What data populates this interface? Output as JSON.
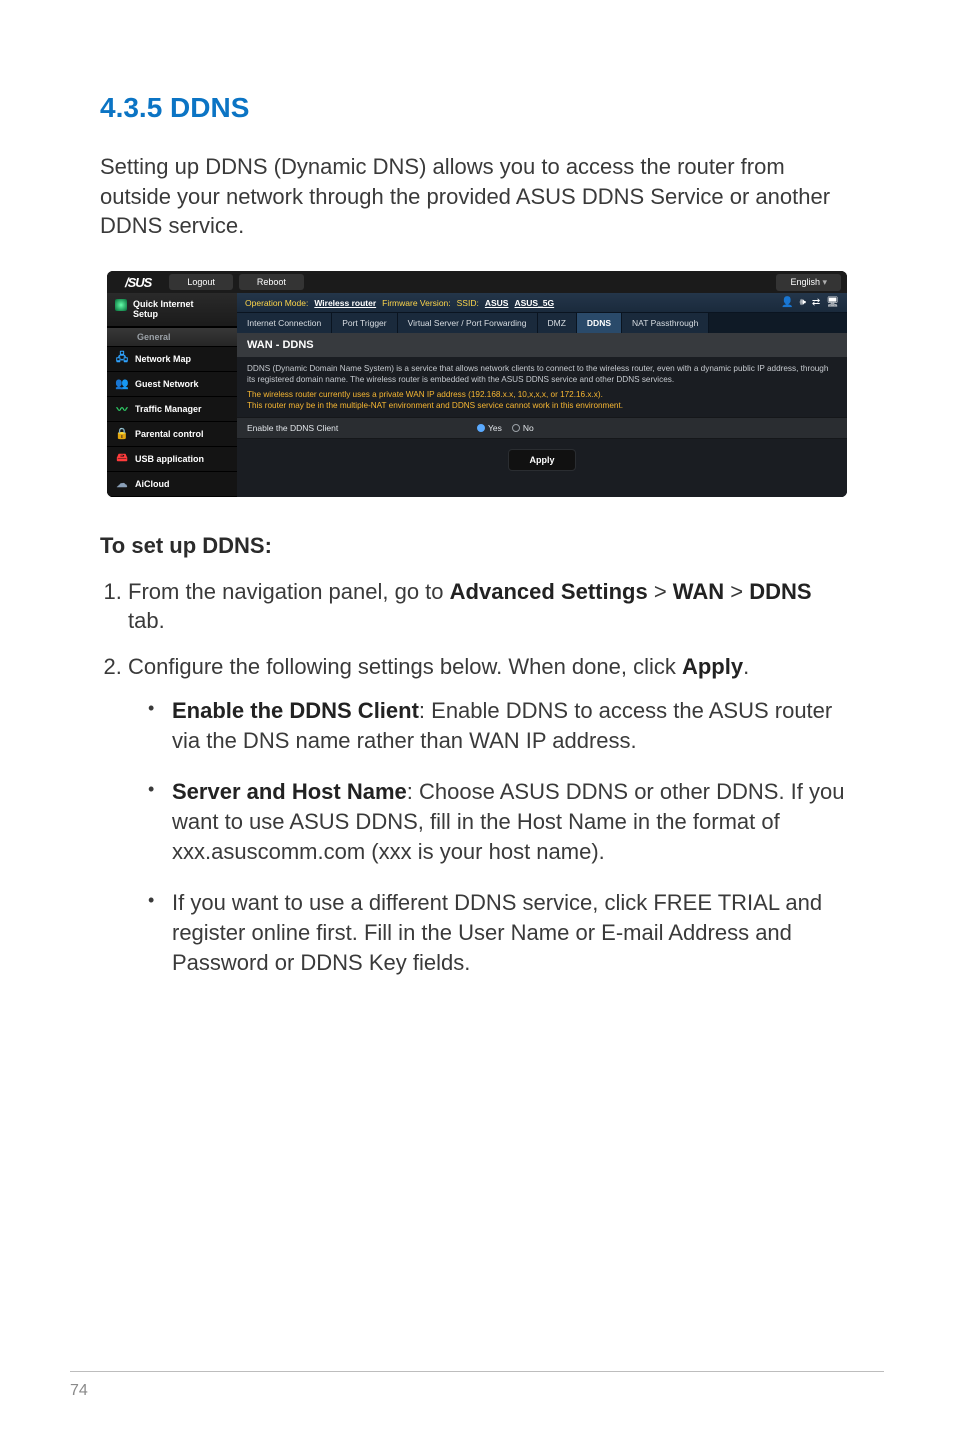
{
  "doc": {
    "section_number": "4.3.5",
    "section_name": "DDNS",
    "section_title": "4.3.5 DDNS",
    "intro": "Setting up DDNS (Dynamic DNS) allows you to access the router from outside your network through the provided ASUS DDNS Service or another DDNS service.",
    "subhead": "To set up DDNS:",
    "steps": {
      "s1_pre": "From the navigation panel, go to ",
      "s1_b1": "Advanced Settings",
      "s1_gt1": " > ",
      "s1_b2": "WAN",
      "s1_gt2": " > ",
      "s1_b3": "DDNS",
      "s1_post": " tab.",
      "s2_pre": "Configure the following settings below. When done, click ",
      "s2_b1": "Apply",
      "s2_post": "."
    },
    "bullets": {
      "b1_b": "Enable the DDNS Client",
      "b1_t": ": Enable DDNS to access the ASUS router via the DNS name rather than WAN IP address.",
      "b2_b": "Server and Host Name",
      "b2_t": ": Choose ASUS DDNS or other DDNS. If you want to use ASUS DDNS, fill in the Host Name in the format of xxx.asuscomm.com (xxx is your host name).",
      "b3_t": "If you want to use a different DDNS service, click FREE TRIAL and register online first. Fill in the User Name or E-mail Address and Password or DDNS Key fields."
    },
    "page_number": "74"
  },
  "shot": {
    "brand": "/SUS",
    "top": {
      "logout": "Logout",
      "reboot": "Reboot",
      "language": "English"
    },
    "side": {
      "qis_l1": "Quick Internet",
      "qis_l2": "Setup",
      "group": "General",
      "items": [
        {
          "icon": "🖧",
          "color": "#2fa3ff",
          "label": "Network Map"
        },
        {
          "icon": "👥",
          "color": "#ff5a3c",
          "label": "Guest Network"
        },
        {
          "icon": "〰",
          "color": "#2fd56a",
          "label": "Traffic Manager"
        },
        {
          "icon": "🔒",
          "color": "#ffb000",
          "label": "Parental control"
        },
        {
          "icon": "🖴",
          "color": "#ff3b3b",
          "label": "USB application"
        },
        {
          "icon": "☁",
          "color": "#8aa0b8",
          "label": "AiCloud"
        }
      ]
    },
    "info": {
      "op_lbl": "Operation Mode:",
      "op_val": "Wireless router",
      "fw_lbl": "Firmware Version:",
      "ssid_lbl": "SSID:",
      "ssid_v1": "ASUS",
      "ssid_v2": "ASUS_5G"
    },
    "tabs": [
      "Internet Connection",
      "Port Trigger",
      "Virtual Server / Port Forwarding",
      "DMZ",
      "DDNS",
      "NAT Passthrough"
    ],
    "panel_title": "WAN - DDNS",
    "desc": "DDNS (Dynamic Domain Name System) is a service that allows network clients to connect to the wireless router, even with a dynamic public IP address, through its registered domain name. The wireless router is embedded with the ASUS DDNS service and other DDNS services.",
    "warn1": "The wireless router currently uses a private WAN IP address (192.168.x.x, 10,x,x,x, or 172.16.x.x).",
    "warn2": "This router may be in the multiple-NAT environment and DDNS service cannot work in this environment.",
    "form": {
      "label": "Enable the DDNS Client",
      "yes": "Yes",
      "no": "No"
    },
    "apply": "Apply"
  }
}
